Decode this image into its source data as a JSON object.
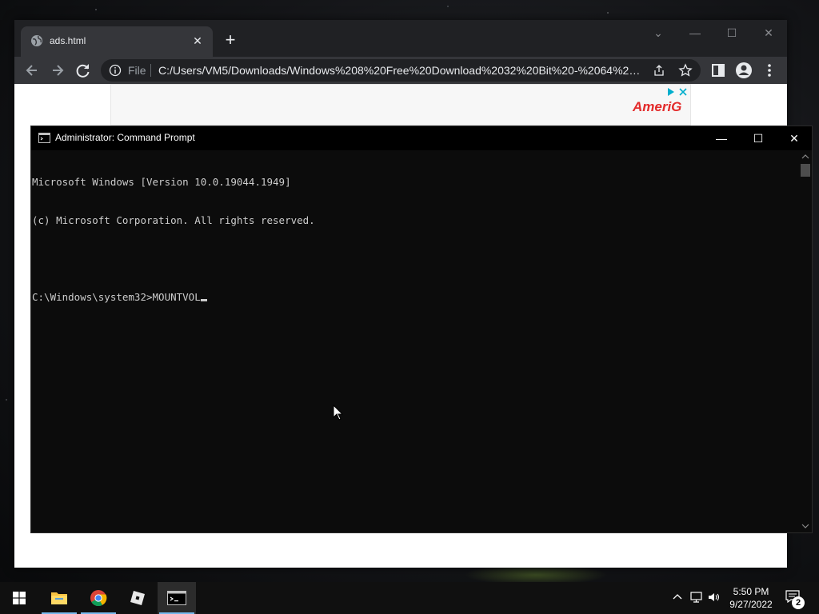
{
  "browser": {
    "tab_title": "ads.html",
    "address_prefix": "File",
    "url": "C:/Users/VM5/Downloads/Windows%208%20Free%20Download%2032%20Bit%20-%2064%20Bi...",
    "ad_logo": "AmeriG",
    "icons": [
      "globe-icon",
      "close-icon",
      "plus-icon",
      "back-icon",
      "forward-icon",
      "reload-icon",
      "info-icon",
      "share-icon",
      "star-icon",
      "side-panel-icon",
      "profile-icon",
      "menu-icon"
    ]
  },
  "cmd": {
    "title": "Administrator: Command Prompt",
    "lines": [
      "Microsoft Windows [Version 10.0.19044.1949]",
      "(c) Microsoft Corporation. All rights reserved.",
      "",
      "C:\\Windows\\system32>MOUNTVOL"
    ]
  },
  "taskbar": {
    "time": "5:50 PM",
    "date": "9/27/2022",
    "notification_count": "2",
    "apps": [
      "windows-start-icon",
      "file-explorer-icon",
      "chrome-icon",
      "roblox-icon",
      "cmd-icon"
    ]
  },
  "colors": {
    "console_bg": "#0c0c0c",
    "console_text": "#cccccc",
    "chrome_dark": "#35363a",
    "accent": "#76b9ed"
  }
}
